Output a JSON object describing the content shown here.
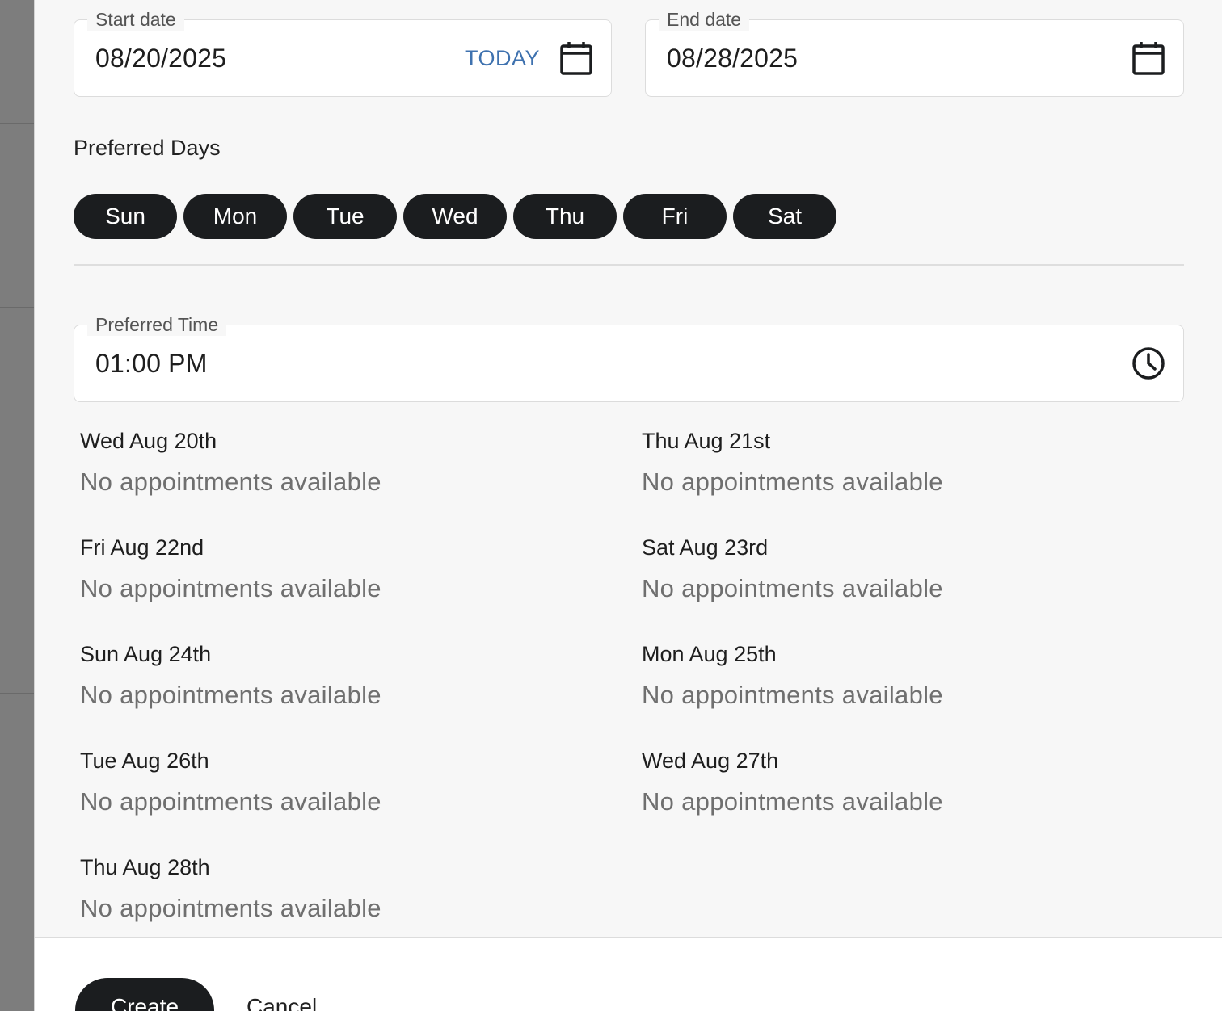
{
  "form": {
    "start_date": {
      "label": "Start date",
      "value": "08/20/2025",
      "today_label": "TODAY",
      "icon": "calendar-icon"
    },
    "end_date": {
      "label": "End date",
      "value": "08/28/2025",
      "icon": "calendar-icon"
    },
    "preferred_days": {
      "title": "Preferred Days",
      "days": [
        "Sun",
        "Mon",
        "Tue",
        "Wed",
        "Thu",
        "Fri",
        "Sat"
      ]
    },
    "preferred_time": {
      "label": "Preferred Time",
      "value": "01:00 PM",
      "icon": "clock-icon"
    }
  },
  "slots": [
    {
      "date": "Wed Aug 20th",
      "status": "No appointments available"
    },
    {
      "date": "Thu Aug 21st",
      "status": "No appointments available"
    },
    {
      "date": "Fri Aug 22nd",
      "status": "No appointments available"
    },
    {
      "date": "Sat Aug 23rd",
      "status": "No appointments available"
    },
    {
      "date": "Sun Aug 24th",
      "status": "No appointments available"
    },
    {
      "date": "Mon Aug 25th",
      "status": "No appointments available"
    },
    {
      "date": "Tue Aug 26th",
      "status": "No appointments available"
    },
    {
      "date": "Wed Aug 27th",
      "status": "No appointments available"
    },
    {
      "date": "Thu Aug 28th",
      "status": "No appointments available"
    }
  ],
  "footer": {
    "create_label": "Create",
    "cancel_label": "Cancel"
  },
  "colors": {
    "pill": "#1b1d1f",
    "today_link": "#3f72af",
    "background": "#f7f7f7"
  }
}
